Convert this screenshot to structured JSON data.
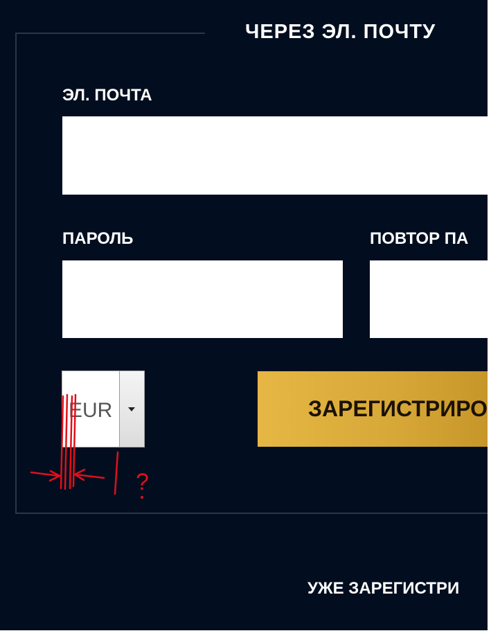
{
  "form": {
    "title": "ЧЕРЕЗ ЭЛ. ПОЧТУ",
    "email_label": "ЭЛ. ПОЧТА",
    "email_value": "",
    "password_label": "ПАРОЛЬ",
    "password_value": "",
    "repeat_password_label": "ПОВТОР ПА",
    "repeat_password_value": "",
    "currency": {
      "selected": "EUR"
    },
    "register_button": "ЗАРЕГИСТРИРО",
    "already_registered": "УЖЕ ЗАРЕГИСТРИ"
  },
  "annotation": {
    "question_mark": "?",
    "color": "#e0101a"
  },
  "colors": {
    "background": "#020e1f",
    "accent_gold": "#d9aa3a",
    "text": "#ffffff"
  },
  "icons": {
    "dropdown_arrow": "chevron-down-icon"
  }
}
